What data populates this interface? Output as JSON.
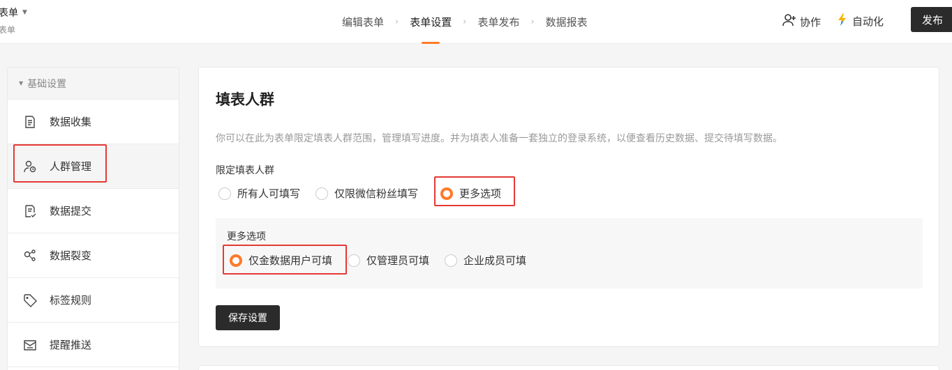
{
  "header": {
    "form_name": "表单",
    "form_sub": "表单",
    "steps": [
      "编辑表单",
      "表单设置",
      "表单发布",
      "数据报表"
    ],
    "active_step": 1,
    "collab_label": "协作",
    "auto_label": "自动化",
    "publish_label": "发布",
    "accent_color": "#ff7a29"
  },
  "sidebar": {
    "section_label": "基础设置",
    "items": [
      {
        "label": "数据收集",
        "icon": "document-icon"
      },
      {
        "label": "人群管理",
        "icon": "user-settings-icon"
      },
      {
        "label": "数据提交",
        "icon": "submit-document-icon"
      },
      {
        "label": "数据裂变",
        "icon": "share-nodes-icon"
      },
      {
        "label": "标签规则",
        "icon": "tag-icon"
      },
      {
        "label": "提醒推送",
        "icon": "push-notification-icon"
      }
    ],
    "active_index": 1
  },
  "main": {
    "title": "填表人群",
    "description": "你可以在此为表单限定填表人群范围，管理填写进度。并为填表人准备一套独立的登录系统，以便查看历史数据、提交待填写数据。",
    "restrict_label": "限定填表人群",
    "restrict_options": [
      "所有人可填写",
      "仅限微信粉丝填写",
      "更多选项"
    ],
    "restrict_selected": 2,
    "more_label": "更多选项",
    "more_options": [
      "仅金数据用户可填",
      "仅管理员可填",
      "企业成员可填"
    ],
    "more_selected": 0,
    "save_label": "保存设置"
  }
}
